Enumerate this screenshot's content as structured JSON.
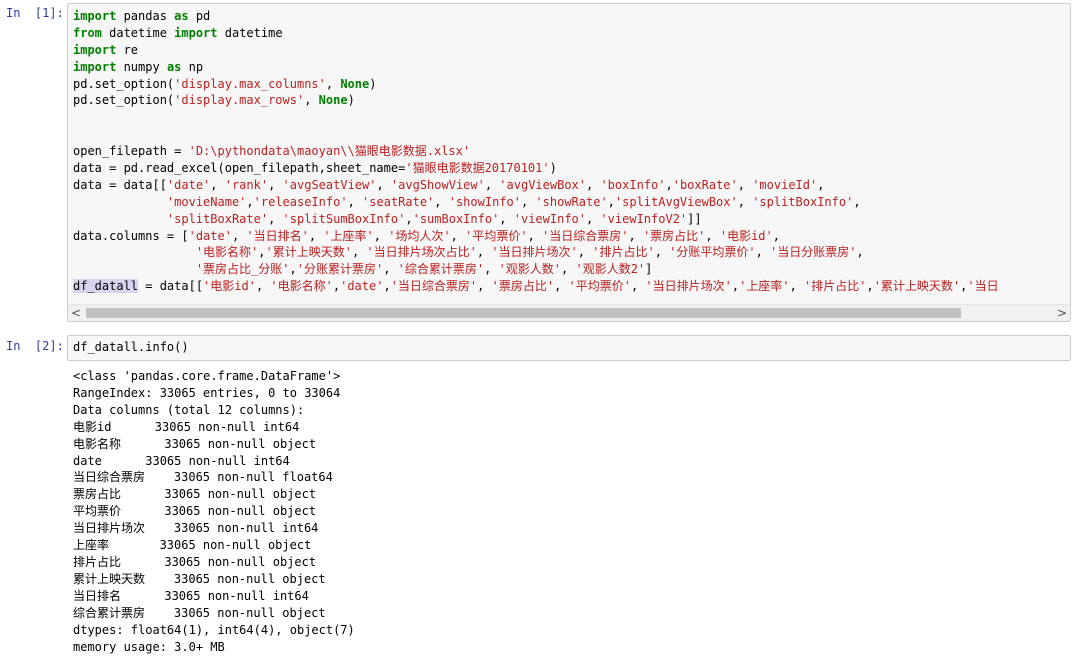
{
  "cell1": {
    "prompt": "In  [1]:",
    "code_lines": [
      [
        {
          "t": "import",
          "c": "kw"
        },
        {
          "t": " pandas "
        },
        {
          "t": "as",
          "c": "kw"
        },
        {
          "t": " pd"
        }
      ],
      [
        {
          "t": "from",
          "c": "kw"
        },
        {
          "t": " datetime "
        },
        {
          "t": "import",
          "c": "kw"
        },
        {
          "t": " datetime"
        }
      ],
      [
        {
          "t": "import",
          "c": "kw"
        },
        {
          "t": " re"
        }
      ],
      [
        {
          "t": "import",
          "c": "kw"
        },
        {
          "t": " numpy "
        },
        {
          "t": "as",
          "c": "kw"
        },
        {
          "t": " np"
        }
      ],
      [
        {
          "t": "pd.set_option("
        },
        {
          "t": "'display.max_columns'",
          "c": "st"
        },
        {
          "t": ", "
        },
        {
          "t": "None",
          "c": "kw"
        },
        {
          "t": ")"
        }
      ],
      [
        {
          "t": "pd.set_option("
        },
        {
          "t": "'display.max_rows'",
          "c": "st"
        },
        {
          "t": ", "
        },
        {
          "t": "None",
          "c": "kw"
        },
        {
          "t": ")"
        }
      ],
      [],
      [],
      [
        {
          "t": "open_filepath = "
        },
        {
          "t": "'D:\\pythondata\\maoyan\\\\猫眼电影数据.xlsx'",
          "c": "st"
        }
      ],
      [
        {
          "t": "data = pd.read_excel(open_filepath,sheet_name="
        },
        {
          "t": "'猫眼电影数据20170101'",
          "c": "st"
        },
        {
          "t": ")"
        }
      ],
      [
        {
          "t": "data = data[["
        },
        {
          "t": "'date'",
          "c": "st"
        },
        {
          "t": ", "
        },
        {
          "t": "'rank'",
          "c": "st"
        },
        {
          "t": ", "
        },
        {
          "t": "'avgSeatView'",
          "c": "st"
        },
        {
          "t": ", "
        },
        {
          "t": "'avgShowView'",
          "c": "st"
        },
        {
          "t": ", "
        },
        {
          "t": "'avgViewBox'",
          "c": "st"
        },
        {
          "t": ", "
        },
        {
          "t": "'boxInfo'",
          "c": "st"
        },
        {
          "t": ","
        },
        {
          "t": "'boxRate'",
          "c": "st"
        },
        {
          "t": ", "
        },
        {
          "t": "'movieId'",
          "c": "st"
        },
        {
          "t": ","
        }
      ],
      [
        {
          "t": "             "
        },
        {
          "t": "'movieName'",
          "c": "st"
        },
        {
          "t": ","
        },
        {
          "t": "'releaseInfo'",
          "c": "st"
        },
        {
          "t": ", "
        },
        {
          "t": "'seatRate'",
          "c": "st"
        },
        {
          "t": ", "
        },
        {
          "t": "'showInfo'",
          "c": "st"
        },
        {
          "t": ", "
        },
        {
          "t": "'showRate'",
          "c": "st"
        },
        {
          "t": ","
        },
        {
          "t": "'splitAvgViewBox'",
          "c": "st"
        },
        {
          "t": ", "
        },
        {
          "t": "'splitBoxInfo'",
          "c": "st"
        },
        {
          "t": ","
        }
      ],
      [
        {
          "t": "             "
        },
        {
          "t": "'splitBoxRate'",
          "c": "st"
        },
        {
          "t": ", "
        },
        {
          "t": "'splitSumBoxInfo'",
          "c": "st"
        },
        {
          "t": ","
        },
        {
          "t": "'sumBoxInfo'",
          "c": "st"
        },
        {
          "t": ", "
        },
        {
          "t": "'viewInfo'",
          "c": "st"
        },
        {
          "t": ", "
        },
        {
          "t": "'viewInfoV2'",
          "c": "st"
        },
        {
          "t": "]]"
        }
      ],
      [
        {
          "t": "data.columns = ["
        },
        {
          "t": "'date'",
          "c": "st"
        },
        {
          "t": ", "
        },
        {
          "t": "'当日排名'",
          "c": "st"
        },
        {
          "t": ", "
        },
        {
          "t": "'上座率'",
          "c": "st"
        },
        {
          "t": ", "
        },
        {
          "t": "'场均人次'",
          "c": "st"
        },
        {
          "t": ", "
        },
        {
          "t": "'平均票价'",
          "c": "st"
        },
        {
          "t": ", "
        },
        {
          "t": "'当日综合票房'",
          "c": "st"
        },
        {
          "t": ", "
        },
        {
          "t": "'票房占比'",
          "c": "st"
        },
        {
          "t": ", "
        },
        {
          "t": "'电影id'",
          "c": "st"
        },
        {
          "t": ","
        }
      ],
      [
        {
          "t": "                 "
        },
        {
          "t": "'电影名称'",
          "c": "st"
        },
        {
          "t": ","
        },
        {
          "t": "'累计上映天数'",
          "c": "st"
        },
        {
          "t": ", "
        },
        {
          "t": "'当日排片场次占比'",
          "c": "st"
        },
        {
          "t": ", "
        },
        {
          "t": "'当日排片场次'",
          "c": "st"
        },
        {
          "t": ", "
        },
        {
          "t": "'排片占比'",
          "c": "st"
        },
        {
          "t": ", "
        },
        {
          "t": "'分账平均票价'",
          "c": "st"
        },
        {
          "t": ", "
        },
        {
          "t": "'当日分账票房'",
          "c": "st"
        },
        {
          "t": ","
        }
      ],
      [
        {
          "t": "                 "
        },
        {
          "t": "'票房占比_分账'",
          "c": "st"
        },
        {
          "t": ","
        },
        {
          "t": "'分账累计票房'",
          "c": "st"
        },
        {
          "t": ", "
        },
        {
          "t": "'综合累计票房'",
          "c": "st"
        },
        {
          "t": ", "
        },
        {
          "t": "'观影人数'",
          "c": "st"
        },
        {
          "t": ", "
        },
        {
          "t": "'观影人数2'",
          "c": "st"
        },
        {
          "t": "]"
        }
      ],
      [
        {
          "t": "df_datall",
          "c": "hl"
        },
        {
          "t": " = data[["
        },
        {
          "t": "'电影id'",
          "c": "st"
        },
        {
          "t": ", "
        },
        {
          "t": "'电影名称'",
          "c": "st"
        },
        {
          "t": ","
        },
        {
          "t": "'date'",
          "c": "st"
        },
        {
          "t": ","
        },
        {
          "t": "'当日综合票房'",
          "c": "st"
        },
        {
          "t": ", "
        },
        {
          "t": "'票房占比'",
          "c": "st"
        },
        {
          "t": ", "
        },
        {
          "t": "'平均票价'",
          "c": "st"
        },
        {
          "t": ", "
        },
        {
          "t": "'当日排片场次'",
          "c": "st"
        },
        {
          "t": ","
        },
        {
          "t": "'上座率'",
          "c": "st"
        },
        {
          "t": ", "
        },
        {
          "t": "'排片占比'",
          "c": "st"
        },
        {
          "t": ","
        },
        {
          "t": "'累计上映天数'",
          "c": "st"
        },
        {
          "t": ","
        },
        {
          "t": "'当日",
          "c": "st"
        }
      ]
    ],
    "scroll_left": "<",
    "scroll_right": ">"
  },
  "cell2": {
    "prompt": "In  [2]:",
    "code": "df_datall.info()",
    "output": "<class 'pandas.core.frame.DataFrame'>\nRangeIndex: 33065 entries, 0 to 33064\nData columns (total 12 columns):\n电影id      33065 non-null int64\n电影名称      33065 non-null object\ndate      33065 non-null int64\n当日综合票房    33065 non-null float64\n票房占比      33065 non-null object\n平均票价      33065 non-null object\n当日排片场次    33065 non-null int64\n上座率       33065 non-null object\n排片占比      33065 non-null object\n累计上映天数    33065 non-null object\n当日排名      33065 non-null int64\n综合累计票房    33065 non-null object\ndtypes: float64(1), int64(4), object(7)\nmemory usage: 3.0+ MB"
  }
}
